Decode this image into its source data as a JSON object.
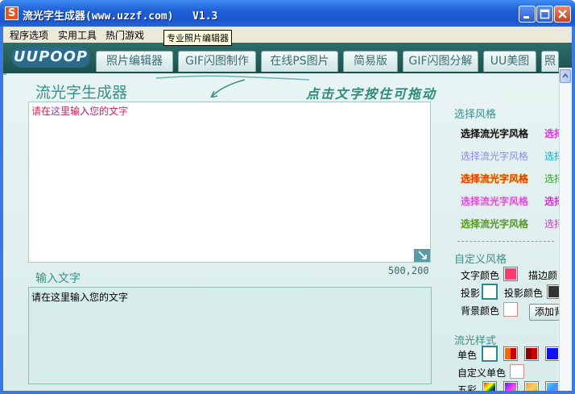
{
  "window": {
    "app_icon": "S",
    "title": "流光字生成器(www.uzzf.com)   V1.3"
  },
  "menu": [
    "程序选项",
    "实用工具",
    "热门游戏"
  ],
  "logo": "UUPOOP",
  "tabs": [
    "照片编辑器",
    "GIF闪图制作",
    "在线PS图片",
    "简易版",
    "GIF闪图分解",
    "UU美图",
    "照"
  ],
  "tooltip": "专业照片编辑器",
  "generator": {
    "title": "流光字生成器",
    "hint": "点击文字按住可拖动",
    "canvas_text": "请在这里输入您的文字",
    "canvas_size": "500,200",
    "input_label": "输入文字",
    "input_value": "请在这里输入您的文字"
  },
  "right_panel": {
    "style_title": "选择风格",
    "styles": [
      {
        "label": "选择流光字风格",
        "more": "选择",
        "color": "#111111"
      },
      {
        "label": "选择流光字风格",
        "more": "选择",
        "color": "#8a8ae6"
      },
      {
        "label": "选择流光字风格",
        "more": "选择",
        "color": "#e63b10"
      },
      {
        "label": "选择流光字风格",
        "more": "选择",
        "color": "#d13bd9"
      },
      {
        "label": "选择流光字风格",
        "more": "选择",
        "color": "#5a9a20"
      }
    ],
    "custom_title": "自定义风格",
    "text_color_label": "文字颜色",
    "stroke_color_label": "描边颜",
    "shadow_label": "投影",
    "shadow_color_label": "投影颜色",
    "bg_color_label": "背景颜色",
    "add_bg_button": "添加背",
    "flow_title": "流光样式",
    "single_label": "单色",
    "custom_single_label": "自定义单色",
    "multi_label": "五彩",
    "colors": {
      "text_color": "#ff3b6b",
      "shadow_color": "#333333",
      "accent": "#3c8f8a"
    }
  }
}
